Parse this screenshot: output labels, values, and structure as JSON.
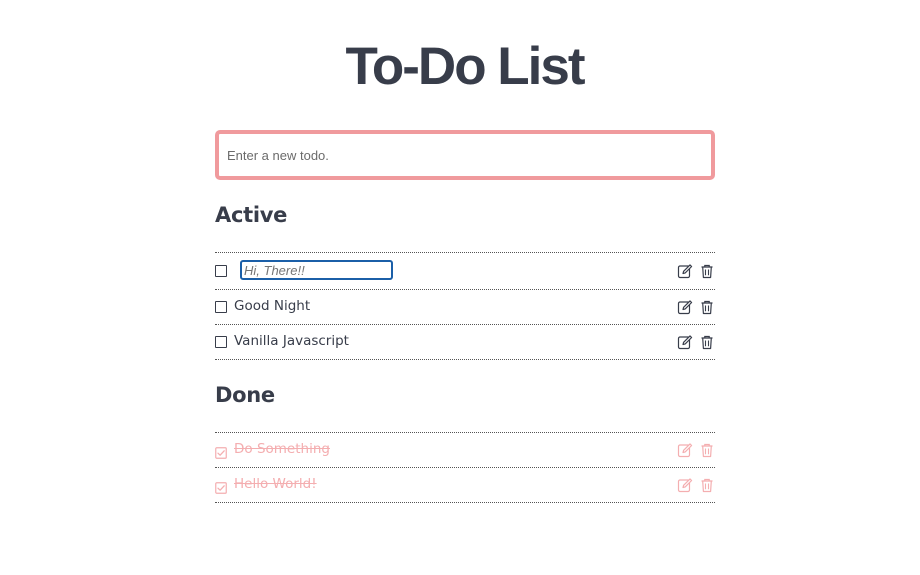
{
  "page": {
    "title": "To-Do List"
  },
  "new_todo": {
    "placeholder": "Enter a new todo.",
    "value": ""
  },
  "active": {
    "heading": "Active",
    "items": [
      {
        "label": "Hi, There!!",
        "editing": true
      },
      {
        "label": "Good Night",
        "editing": false
      },
      {
        "label": "Vanilla Javascript",
        "editing": false
      }
    ]
  },
  "done": {
    "heading": "Done",
    "items": [
      {
        "label": "Do Something"
      },
      {
        "label": "Hello World!"
      }
    ]
  },
  "colors": {
    "text": "#383d4a",
    "accent_border": "#f09a9d",
    "done_text": "#f4aeb0",
    "edit_focus": "#1b5fa8"
  },
  "icons": {
    "edit": "edit-icon",
    "delete": "trash-icon",
    "checkbox_empty": "checkbox-empty-icon",
    "checkbox_checked": "checkbox-checked-icon"
  }
}
